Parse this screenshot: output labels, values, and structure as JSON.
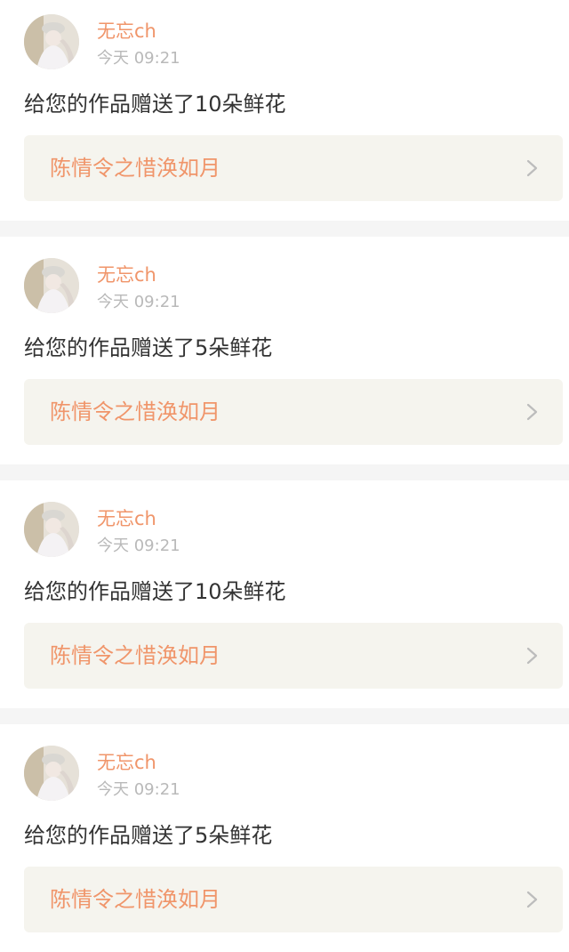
{
  "notifications": [
    {
      "username": "无忘ch",
      "time": "今天 09:21",
      "message": "给您的作品赠送了10朵鲜花",
      "work_title": "陈情令之惜涣如月"
    },
    {
      "username": "无忘ch",
      "time": "今天 09:21",
      "message": "给您的作品赠送了5朵鲜花",
      "work_title": "陈情令之惜涣如月"
    },
    {
      "username": "无忘ch",
      "time": "今天 09:21",
      "message": "给您的作品赠送了10朵鲜花",
      "work_title": "陈情令之惜涣如月"
    },
    {
      "username": "无忘ch",
      "time": "今天 09:21",
      "message": "给您的作品赠送了5朵鲜花",
      "work_title": "陈情令之惜涣如月"
    }
  ],
  "icons": {
    "chevron": "chevron-right-icon",
    "avatar": "avatar"
  },
  "colors": {
    "accent": "#f0956a",
    "tab_indicator": "#f06a9a",
    "card_background": "#f5f4ee",
    "divider": "#f5f5f5"
  }
}
